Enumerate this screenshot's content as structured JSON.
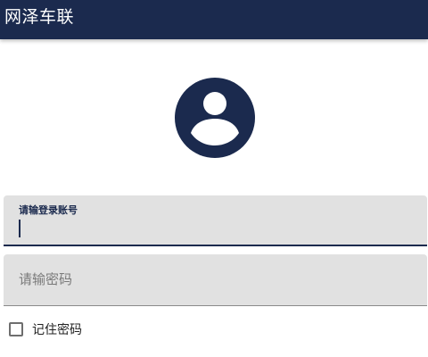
{
  "app_bar": {
    "title": "网泽车联",
    "background_color": "#1b2a4e"
  },
  "avatar": {
    "icon": "account-circle-icon",
    "color": "#1b2a4e"
  },
  "login_form": {
    "account": {
      "label": "请输登录账号",
      "value": ""
    },
    "password": {
      "placeholder": "请输密码",
      "value": ""
    },
    "remember_password": {
      "label": "记住密码",
      "checked": false
    }
  }
}
